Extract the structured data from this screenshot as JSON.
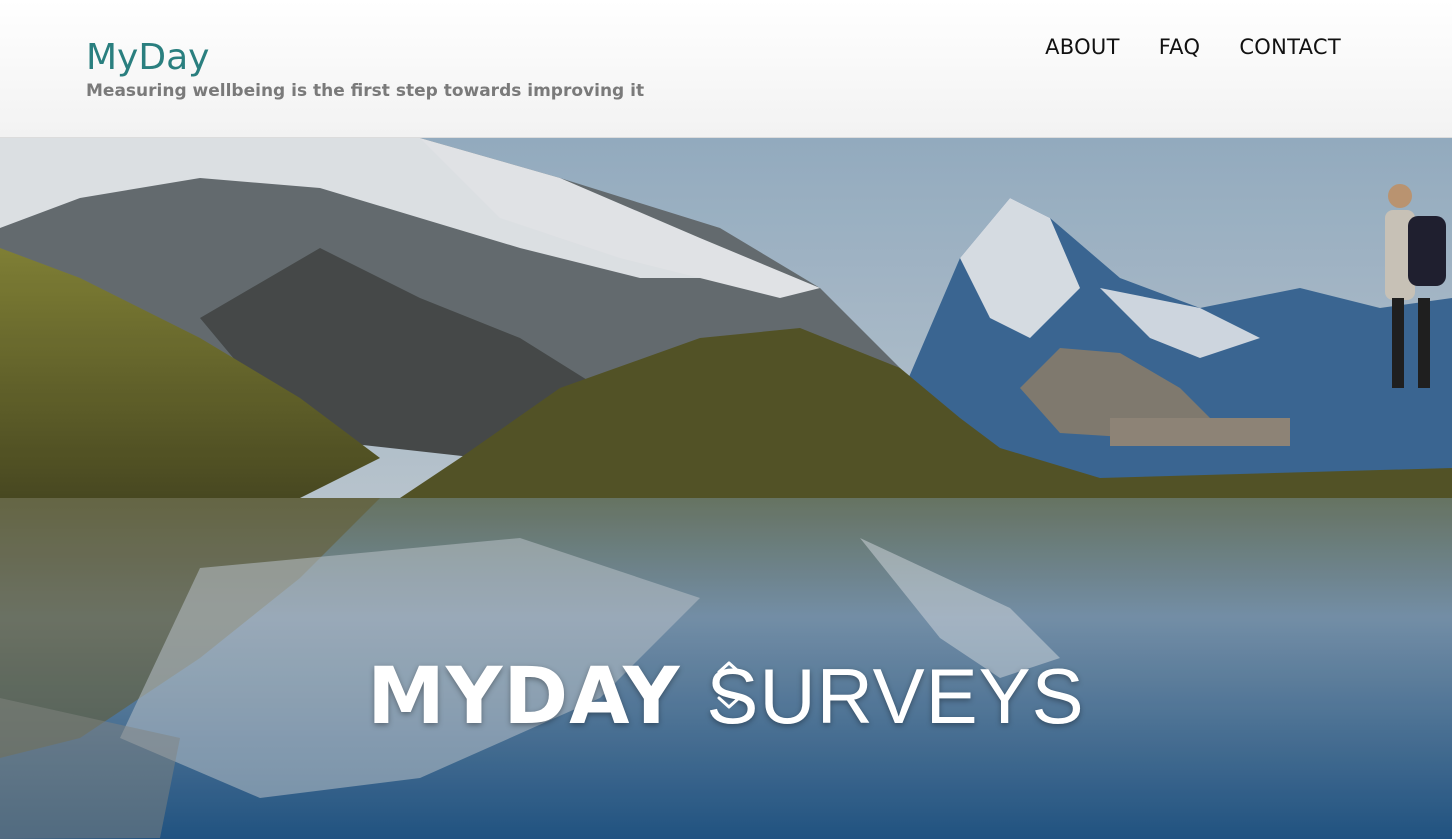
{
  "site": {
    "brand": "MyDay",
    "tagline": "Measuring wellbeing is the first step towards improving it"
  },
  "nav": {
    "items": [
      {
        "label": "ABOUT"
      },
      {
        "label": "FAQ"
      },
      {
        "label": "CONTACT"
      }
    ]
  },
  "hero": {
    "title_strong": "MYDAY",
    "title_light": "SURVEYS",
    "scroll_up_icon": "chevron-up-icon",
    "scroll_down_icon": "chevron-down-icon"
  },
  "colors": {
    "brand": "#2a7f7f",
    "tagline": "#7a7a7a",
    "nav_text": "#111111",
    "hero_text": "#ffffff"
  }
}
